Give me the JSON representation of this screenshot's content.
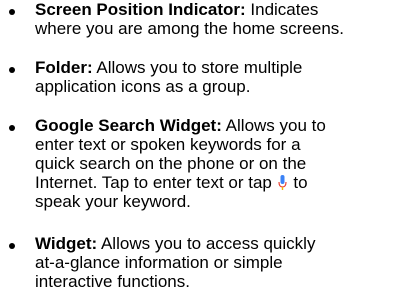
{
  "items": [
    {
      "term": "Screen Position Indicator:",
      "line1_rest": "Indicates",
      "line2": "where you are among the home screens."
    },
    {
      "term": "Folder:",
      "line1_rest": "Allows you to store multiple",
      "line2": "application icons as a group."
    },
    {
      "term": "Google Search Widget:",
      "line1_rest": "Allows you to",
      "line2": "enter text or spoken keywords for a",
      "line3": "quick search on the phone or on the",
      "line4": "Internet. Tap to enter text or tap",
      "line5_after_icon": "to",
      "line6": "speak your keyword."
    },
    {
      "term": "Widget:",
      "line1_rest": "Allows you to access quickly",
      "line2": "at-a-glance information or simple",
      "line3": "interactive functions."
    }
  ],
  "icons": {
    "mic": "microphone-icon",
    "mic_color": "#3b82f6",
    "mic_accent": "#ea4335"
  }
}
